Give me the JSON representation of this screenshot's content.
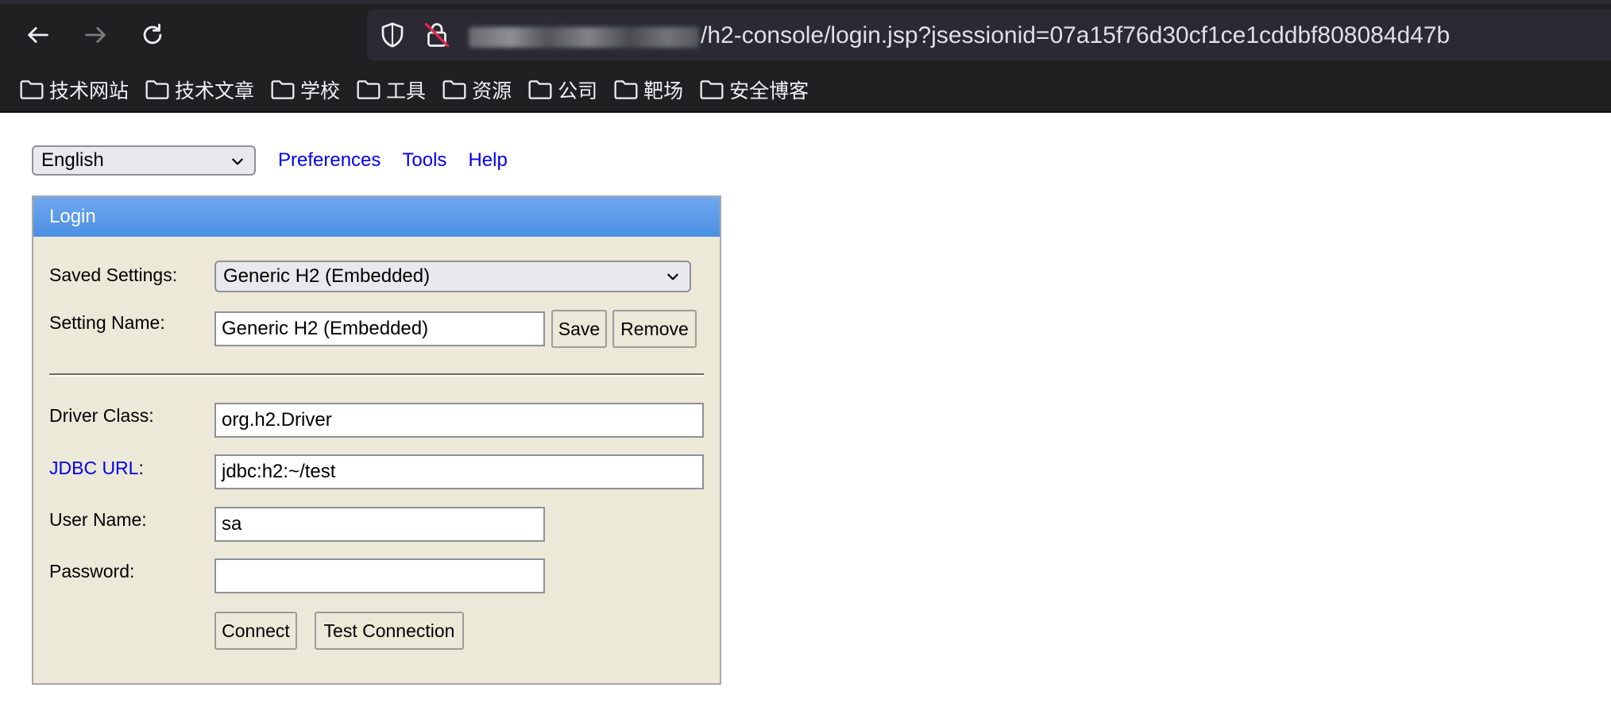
{
  "browser": {
    "url_visible": "/h2-console/login.jsp?jsessionid=07a15f76d30cf1ce1cddbf808084d47b",
    "icons": {
      "back": "back-arrow-icon",
      "forward": "forward-arrow-icon",
      "reload": "reload-icon",
      "shield": "shield-icon",
      "insecure": "insecure-lock-icon"
    },
    "bookmarks": [
      {
        "label": "技术网站",
        "icon": "folder-icon"
      },
      {
        "label": "技术文章",
        "icon": "folder-icon"
      },
      {
        "label": "学校",
        "icon": "folder-icon"
      },
      {
        "label": "工具",
        "icon": "folder-icon"
      },
      {
        "label": "资源",
        "icon": "folder-icon"
      },
      {
        "label": "公司",
        "icon": "folder-icon"
      },
      {
        "label": "靶场",
        "icon": "folder-icon"
      },
      {
        "label": "安全博客",
        "icon": "folder-icon"
      }
    ]
  },
  "toolbar": {
    "language": "English",
    "links": {
      "preferences": "Preferences",
      "tools": "Tools",
      "help": "Help"
    }
  },
  "login": {
    "title": "Login",
    "saved_settings_label": "Saved Settings:",
    "saved_settings_value": "Generic H2 (Embedded)",
    "setting_name_label": "Setting Name:",
    "setting_name_value": "Generic H2 (Embedded)",
    "save_button": "Save",
    "remove_button": "Remove",
    "driver_class_label": "Driver Class:",
    "driver_class_value": "org.h2.Driver",
    "jdbc_url_label": "JDBC URL",
    "jdbc_url_colon": ":",
    "jdbc_url_value": "jdbc:h2:~/test",
    "user_name_label": "User Name:",
    "user_name_value": "sa",
    "password_label": "Password:",
    "password_value": "",
    "connect_button": "Connect",
    "test_connection_button": "Test Connection"
  },
  "colors": {
    "chrome_bg": "#202023",
    "urlbar_bg": "#2b2a33",
    "panel_bg": "#ece9d8",
    "panel_header": "#5b9ae8",
    "link": "#0000ee"
  }
}
